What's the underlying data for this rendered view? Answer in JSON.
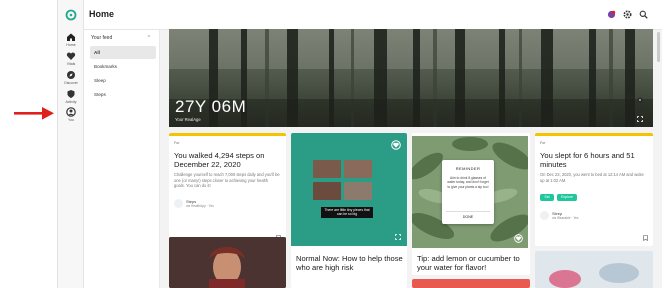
{
  "window_title": "Home",
  "rail": [
    {
      "label": "Home",
      "icon": "home-icon"
    },
    {
      "label": "Vitals",
      "icon": "heart-icon"
    },
    {
      "label": "Discover",
      "icon": "compass-icon"
    },
    {
      "label": "Activity",
      "icon": "shield-icon"
    },
    {
      "label": "You",
      "icon": "person-icon"
    }
  ],
  "feed": {
    "header": "Your feed",
    "items": [
      "All",
      "Bookmarks",
      "Sleep",
      "Steps"
    ]
  },
  "hero": {
    "value": "27Y 06M",
    "caption": "Your RealAge"
  },
  "cards": {
    "steps": {
      "kicker": "For",
      "headline": "You walked 4,294 steps on December 22, 2020",
      "body": "Challenge yourself to reach 7,000 steps daily and you'll be one (or many!) steps closer to achieving your health goals. You can do it!",
      "source": "Steps",
      "source_sub": "via HealthApp · Yes",
      "accent": "#f5c400"
    },
    "video": {
      "caption": "There are little tiny pieces that can be so big",
      "headline": "Normal Now: How to help those who are high risk",
      "accent": "#2b9d86"
    },
    "tip": {
      "reminder_title": "REMINDER",
      "reminder_body": "Aim to drink 8 glasses of water today, and don't forget to give your plants a sip too!",
      "reminder_done": "DONE",
      "headline": "Tip: add lemon or cucumber to your water for flavor!",
      "accent": "#9cc48b"
    },
    "sleep": {
      "kicker": "For",
      "headline": "You slept for 6 hours and 51 minutes",
      "body": "On Dec 23, 2020, you went to bed at 12:14 AM and woke up at 1:02 AM.",
      "btn1": "Set",
      "btn2": "Explore",
      "source": "Sleep",
      "source_sub": "via Wearable · Yes",
      "accent": "#f5c400"
    }
  },
  "colors": {
    "teal": "#1fc79d",
    "arrow": "#e0201b"
  }
}
